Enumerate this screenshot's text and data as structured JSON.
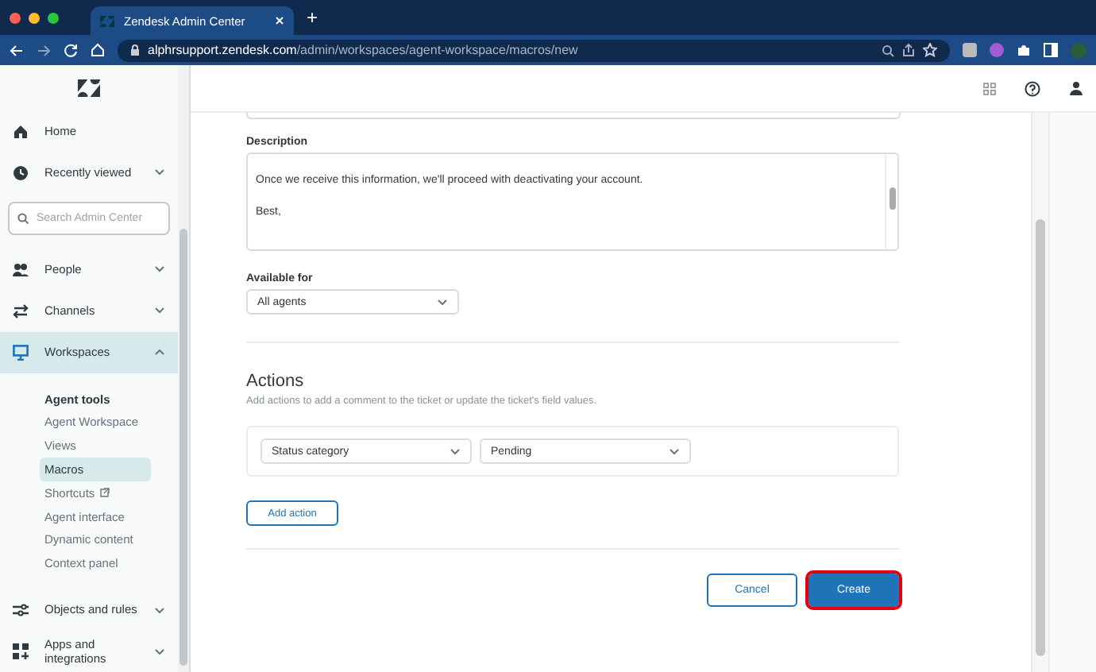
{
  "browser": {
    "tab_title": "Zendesk Admin Center",
    "new_tab": "+",
    "url_host": "alphrsupport.zendesk.com",
    "url_path": "/admin/workspaces/agent-workspace/macros/new"
  },
  "sidebar": {
    "search": {
      "placeholder": "Search Admin Center"
    },
    "top_items": [
      {
        "label": "Home",
        "expandable": false
      },
      {
        "label": "Recently viewed",
        "expandable": true,
        "expanded": false
      }
    ],
    "items": [
      {
        "label": "People",
        "expandable": true,
        "expanded": false,
        "selected": false
      },
      {
        "label": "Channels",
        "expandable": true,
        "expanded": false,
        "selected": false
      },
      {
        "label": "Workspaces",
        "expandable": true,
        "expanded": true,
        "selected": true
      }
    ],
    "sub_heading": "Agent tools",
    "sub_items": [
      {
        "label": "Agent Workspace",
        "selected": false,
        "external": false
      },
      {
        "label": "Views",
        "selected": false,
        "external": false
      },
      {
        "label": "Macros",
        "selected": true,
        "external": false
      },
      {
        "label": "Shortcuts",
        "selected": false,
        "external": true
      },
      {
        "label": "Agent interface",
        "selected": false,
        "external": false
      },
      {
        "label": "Dynamic content",
        "selected": false,
        "external": false
      },
      {
        "label": "Context panel",
        "selected": false,
        "external": false
      }
    ],
    "bottom_items": [
      {
        "label": "Objects and rules",
        "expandable": true,
        "expanded": false
      },
      {
        "label": "Apps and integrations",
        "expandable": true,
        "expanded": false
      }
    ]
  },
  "form": {
    "description": {
      "label": "Description",
      "lines": [
        "Once we receive this information, we'll proceed with deactivating your account.",
        "Best,"
      ]
    },
    "available_for": {
      "label": "Available for",
      "value": "All agents"
    },
    "actions": {
      "heading": "Actions",
      "hint": "Add actions to add a comment to the ticket or update the ticket's field values.",
      "rows": [
        {
          "field": "Status category",
          "value": "Pending"
        }
      ],
      "add_button": "Add action"
    },
    "buttons": [
      {
        "label": "Cancel",
        "kind": "secondary",
        "highlighted": false
      },
      {
        "label": "Create",
        "kind": "primary",
        "highlighted": true
      }
    ]
  }
}
